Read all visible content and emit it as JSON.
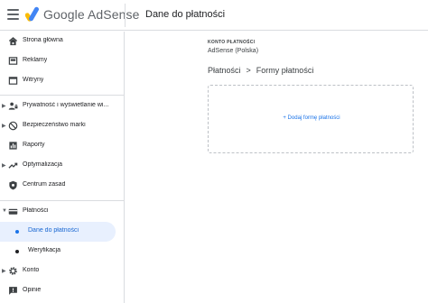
{
  "header": {
    "brand": "Google AdSense",
    "page_title": "Dane do płatności",
    "icons": {
      "menu": "hamburger-menu-icon",
      "logo": "adsense-logo-icon"
    }
  },
  "sidebar": {
    "items": [
      {
        "label": "Strona główna",
        "icon": "home-icon"
      },
      {
        "label": "Reklamy",
        "icon": "ads-icon"
      },
      {
        "label": "Witryny",
        "icon": "sites-icon"
      },
      {
        "label": "Prywatność i wyświetlanie wi...",
        "icon": "privacy-icon",
        "expandable": true
      },
      {
        "label": "Bezpieczeństwo marki",
        "icon": "brand-safety-icon",
        "expandable": true
      },
      {
        "label": "Raporty",
        "icon": "reports-icon"
      },
      {
        "label": "Optymalizacja",
        "icon": "optimization-icon",
        "expandable": true
      },
      {
        "label": "Centrum zasad",
        "icon": "policy-center-icon"
      },
      {
        "label": "Płatności",
        "icon": "payments-icon",
        "expanded": true
      },
      {
        "label": "Dane do płatności",
        "sub": true,
        "active": true
      },
      {
        "label": "Weryfikacja",
        "sub": true
      },
      {
        "label": "Konto",
        "icon": "account-gear-icon",
        "expandable": true
      },
      {
        "label": "Opinie",
        "icon": "feedback-icon"
      }
    ]
  },
  "main": {
    "account_caption": "KONTO PŁATNOŚCI",
    "account_name": "AdSense (Polska)",
    "breadcrumb": {
      "parent": "Płatności",
      "separator": ">",
      "current": "Formy płatności"
    },
    "add_payment_label": "+ Dodaj formę płatności"
  },
  "colors": {
    "accent": "#1a73e8",
    "active_bg": "#e8f0fe",
    "border": "#dadce0",
    "text": "#202124"
  }
}
